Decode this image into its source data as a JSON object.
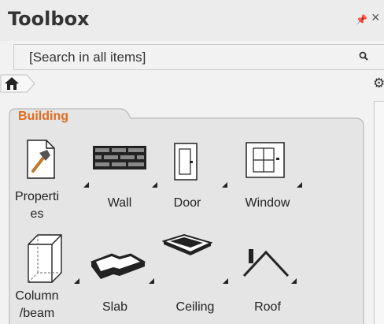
{
  "panel": {
    "title": "Toolbox"
  },
  "search": {
    "placeholder": "[Search in all items]"
  },
  "category": {
    "label": "Building"
  },
  "tools": [
    {
      "label": "Properti\nes",
      "icon": "hammer-properties-icon"
    },
    {
      "label": "Wall",
      "icon": "brick-wall-icon"
    },
    {
      "label": "Door",
      "icon": "door-icon"
    },
    {
      "label": "Window",
      "icon": "window-icon"
    },
    {
      "label": "Column\n/beam",
      "icon": "column-beam-icon"
    },
    {
      "label": "Slab",
      "icon": "slab-icon"
    },
    {
      "label": "Ceiling",
      "icon": "ceiling-icon"
    },
    {
      "label": "Roof",
      "icon": "roof-icon"
    }
  ],
  "colors": {
    "category_accent": "#e06c1f"
  }
}
